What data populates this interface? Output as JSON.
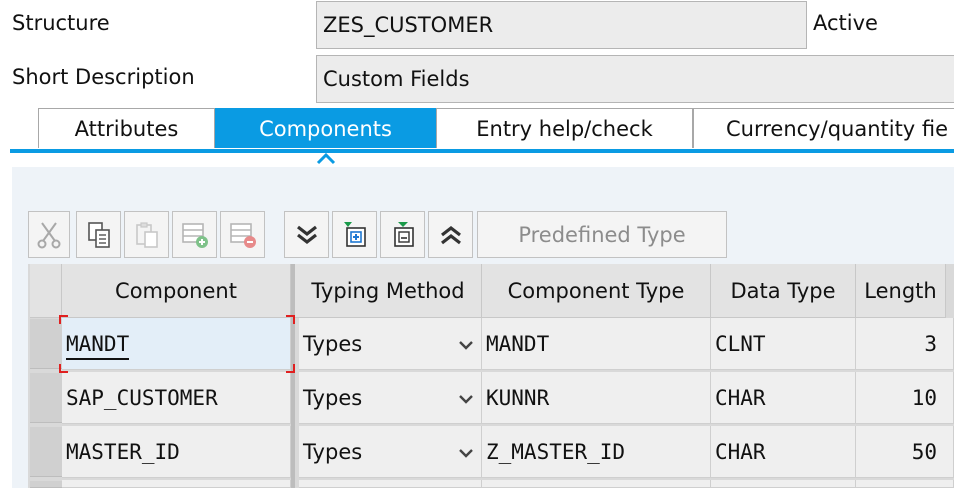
{
  "header": {
    "structure_label": "Structure",
    "structure_value": "ZES_CUSTOMER",
    "status": "Active",
    "short_desc_label": "Short Description",
    "short_desc_value": "Custom Fields"
  },
  "tabs": [
    {
      "label": "Attributes",
      "active": false
    },
    {
      "label": "Components",
      "active": true
    },
    {
      "label": "Entry help/check",
      "active": false
    },
    {
      "label": "Currency/quantity fie",
      "active": false
    }
  ],
  "toolbar": {
    "icons": [
      "cut-icon",
      "copy-icon",
      "paste-icon",
      "insert-row-icon",
      "delete-row-icon",
      "expand-icon",
      "new-item-icon",
      "item-detail-icon",
      "collapse-icon"
    ],
    "predefined_type_label": "Predefined Type"
  },
  "table": {
    "columns": [
      "Component",
      "Typing Method",
      "Component Type",
      "Data Type",
      "Length"
    ],
    "rows": [
      {
        "component": "MANDT",
        "typing": "Types",
        "comp_type": "MANDT",
        "data_type": "CLNT",
        "length": "3"
      },
      {
        "component": "SAP_CUSTOMER",
        "typing": "Types",
        "comp_type": "KUNNR",
        "data_type": "CHAR",
        "length": "10"
      },
      {
        "component": "MASTER_ID",
        "typing": "Types",
        "comp_type": "Z_MASTER_ID",
        "data_type": "CHAR",
        "length": "50"
      }
    ]
  },
  "colors": {
    "accent": "#0a9be3",
    "selection_marker": "#e02020"
  }
}
